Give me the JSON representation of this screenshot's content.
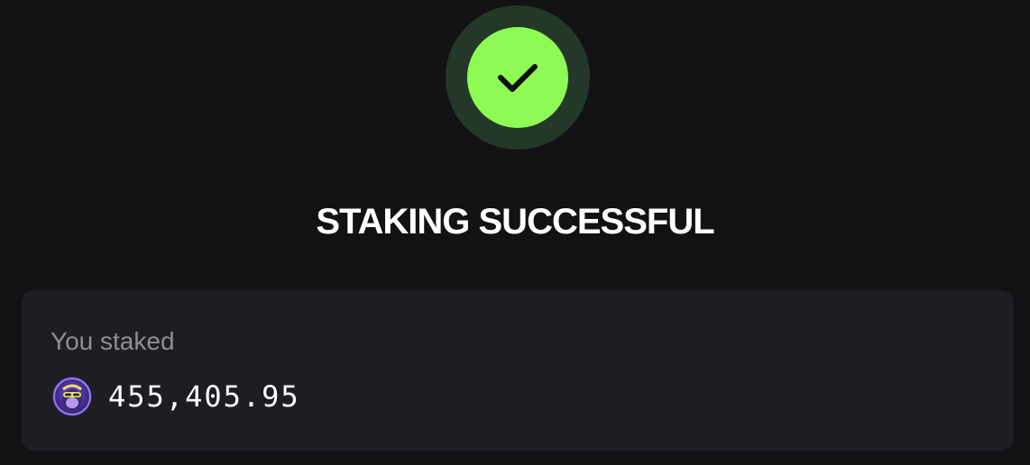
{
  "status": {
    "icon": "checkmark-icon",
    "title": "STAKING SUCCESSFUL",
    "colors": {
      "badge_outer": "#24382a",
      "badge_inner": "#8efb55",
      "check": "#111111"
    }
  },
  "summary": {
    "label": "You staked",
    "amount": "455,405.95",
    "token_icon": "ape-token-icon"
  }
}
